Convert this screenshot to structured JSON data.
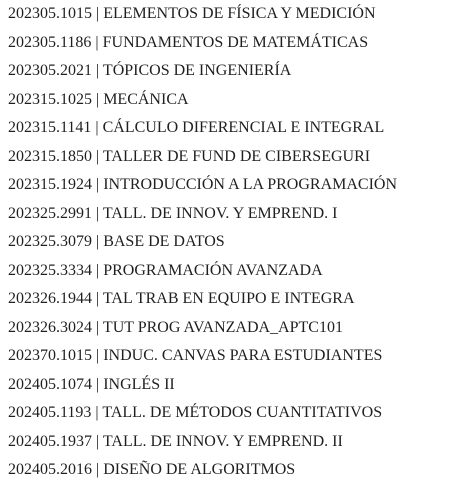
{
  "courses": [
    {
      "label": "202305.1015 | ELEMENTOS DE FÍSICA Y MEDICIÓN"
    },
    {
      "label": "202305.1186 | FUNDAMENTOS DE MATEMÁTICAS"
    },
    {
      "label": "202305.2021 | TÓPICOS DE INGENIERÍA"
    },
    {
      "label": "202315.1025 | MECÁNICA"
    },
    {
      "label": "202315.1141 | CÁLCULO DIFERENCIAL E INTEGRAL"
    },
    {
      "label": "202315.1850 | TALLER DE FUND DE CIBERSEGURI"
    },
    {
      "label": "202315.1924 | INTRODUCCIÓN A LA PROGRAMACIÓN"
    },
    {
      "label": "202325.2991 | TALL. DE INNOV. Y EMPREND. I"
    },
    {
      "label": "202325.3079 | BASE DE DATOS"
    },
    {
      "label": "202325.3334 | PROGRAMACIÓN AVANZADA"
    },
    {
      "label": "202326.1944 | TAL TRAB EN EQUIPO E INTEGRA"
    },
    {
      "label": "202326.3024 | TUT PROG AVANZADA_APTC101"
    },
    {
      "label": "202370.1015 | INDUC. CANVAS PARA ESTUDIANTES"
    },
    {
      "label": "202405.1074 | INGLÉS II"
    },
    {
      "label": "202405.1193 | TALL. DE MÉTODOS CUANTITATIVOS"
    },
    {
      "label": "202405.1937 | TALL. DE INNOV. Y EMPREND. II"
    },
    {
      "label": "202405.2016 | DISEÑO DE ALGORITMOS"
    }
  ]
}
